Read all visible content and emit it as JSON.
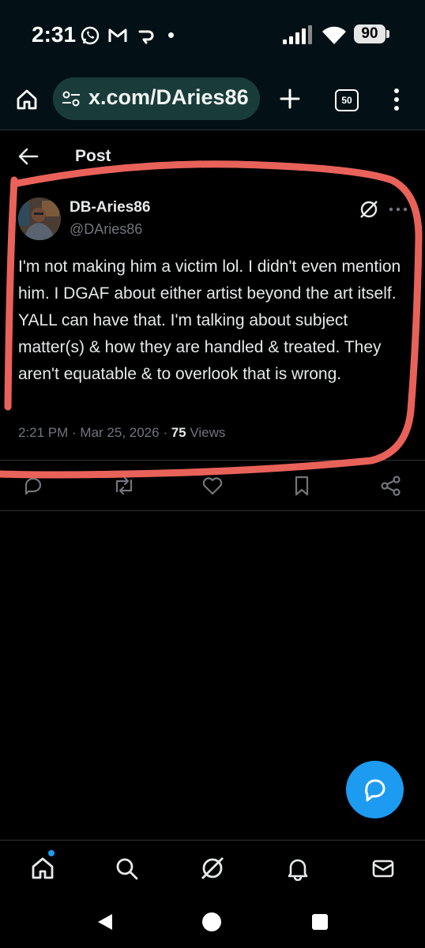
{
  "status_bar": {
    "time": "2:31",
    "battery": "90",
    "icons": [
      "whatsapp-icon",
      "gmail-icon",
      "app-notification-icon",
      "dot-icon",
      "signal-icon",
      "wifi-icon",
      "battery-icon"
    ]
  },
  "browser": {
    "url": "x.com/DAries86",
    "tabs_count": "50",
    "icons": [
      "home-icon",
      "site-settings-icon",
      "new-tab-icon",
      "tabs-icon",
      "menu-icon"
    ]
  },
  "header": {
    "title": "Post"
  },
  "post": {
    "display_name": "DB-Aries86",
    "handle": "@DAries86",
    "text": "I'm not making him a victim lol. I didn't even mention him. I DGAF about either artist beyond the art itself. YALL can have that. I'm talking about subject matter(s) & how they are handled & treated. They aren't equatable & to overlook that is wrong.",
    "timestamp": "2:21 PM · Mar 25, 2026 · ",
    "views_count": "75",
    "views_label": " Views"
  },
  "actions": [
    "reply-icon",
    "repost-icon",
    "like-icon",
    "bookmark-icon",
    "share-icon"
  ],
  "bottom_nav": [
    "home-icon",
    "search-icon",
    "grok-icon",
    "notifications-icon",
    "messages-icon"
  ],
  "colors": {
    "accent": "#1d9bf0",
    "annotation": "#e8625a",
    "url_pill": "#193c39"
  }
}
